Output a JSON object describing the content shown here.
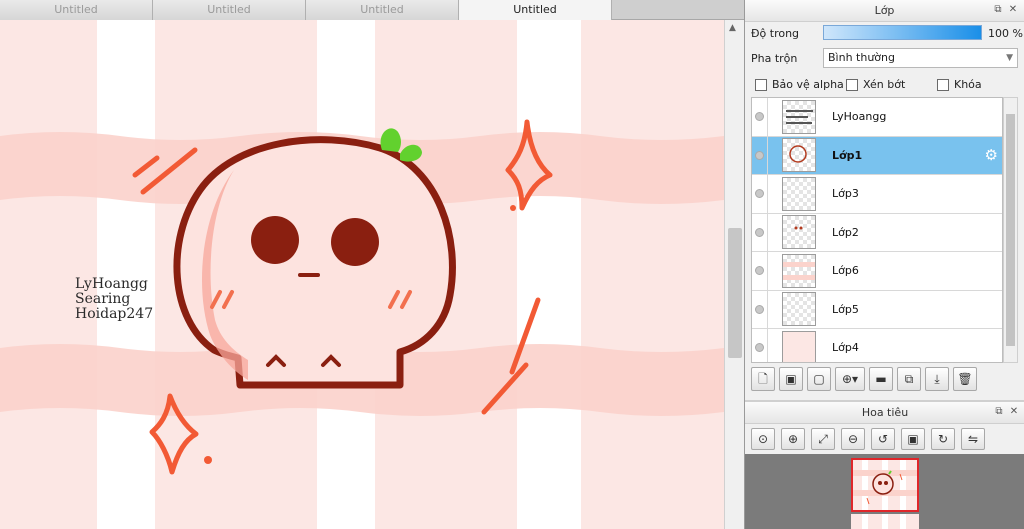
{
  "doc_tabs": [
    "Untitled",
    "Untitled",
    "Untitled",
    "Untitled"
  ],
  "active_tab_index": 3,
  "canvas": {
    "signature_lines": [
      "LyHoangg",
      "Searing",
      "Hoidap247"
    ]
  },
  "layer_panel": {
    "title": "Lớp",
    "opacity_label": "Độ trong",
    "opacity_value": "100 %",
    "opacity_percent": 100,
    "blend_label": "Pha trộn",
    "blend_value": "Bình thường",
    "checkboxes": {
      "protect_alpha": "Bảo vệ alpha",
      "clip": "Xén bớt",
      "lock": "Khóa"
    },
    "layers": [
      {
        "name": "LyHoangg",
        "selected": false
      },
      {
        "name": "Lớp1",
        "selected": true
      },
      {
        "name": "Lớp3",
        "selected": false
      },
      {
        "name": "Lớp2",
        "selected": false
      },
      {
        "name": "Lớp6",
        "selected": false
      },
      {
        "name": "Lớp5",
        "selected": false
      },
      {
        "name": "Lớp4",
        "selected": false
      }
    ]
  },
  "navigator_panel": {
    "title": "Hoa tiêu"
  },
  "colors": {
    "canvas_bg": "#fce7e4",
    "stripe": "#fbd3cc",
    "skull_fill": "#fde3df",
    "skull_outline": "#8a1f10",
    "sparkle": "#f25a35",
    "leaf": "#62d12e",
    "selection": "#79c2ee",
    "nav_frame": "#e0262a"
  }
}
